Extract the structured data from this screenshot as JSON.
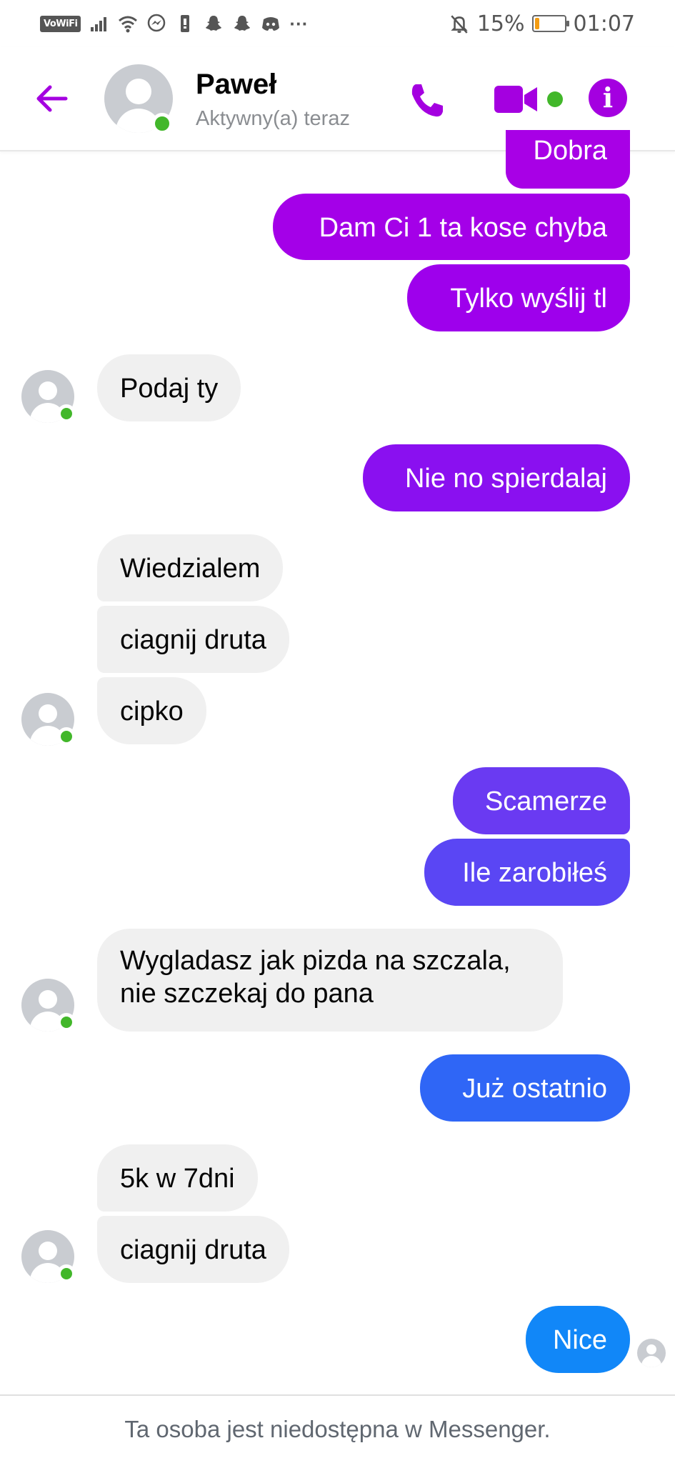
{
  "status_bar": {
    "vowifi": "VoWiFi",
    "battery_percent": "15%",
    "battery_level": 0.15,
    "time": "01:07",
    "more": "···",
    "icons": [
      "signal-icon",
      "wifi-icon",
      "messenger-icon",
      "phone-alert-icon",
      "snapchat-icon",
      "snapchat-icon",
      "discord-icon",
      "mute-bell-icon",
      "battery-icon"
    ]
  },
  "header": {
    "name": "Paweł",
    "status": "Aktywny(a) teraz",
    "accent_color": "#a400e0",
    "icons": [
      "back-arrow-icon",
      "phone-icon",
      "video-camera-icon",
      "info-icon"
    ]
  },
  "messages": [
    {
      "dir": "out",
      "text": "Dobra",
      "color": "#a800e6"
    },
    {
      "dir": "out",
      "text": "Dam Ci 1 ta kose chyba",
      "color": "#a400e8"
    },
    {
      "dir": "out",
      "text": "Tylko wyślij tl",
      "color": "#9e00ec"
    },
    {
      "dir": "in",
      "text": "Podaj ty"
    },
    {
      "dir": "out",
      "text": "Nie no spierdalaj",
      "color": "#8a10f0"
    },
    {
      "dir": "in",
      "text": "Wiedzialem"
    },
    {
      "dir": "in",
      "text": "ciagnij druta"
    },
    {
      "dir": "in",
      "text": "cipko"
    },
    {
      "dir": "out",
      "text": "Scamerze",
      "color": "#6a3af2"
    },
    {
      "dir": "out",
      "text": "Ile zarobiłeś",
      "color": "#5a46f4"
    },
    {
      "dir": "in",
      "text": "Wygladasz jak pizda na szczala, nie szczekaj do pana"
    },
    {
      "dir": "out",
      "text": "Już ostatnio",
      "color": "#2f66f6"
    },
    {
      "dir": "in",
      "text": "5k w 7dni"
    },
    {
      "dir": "in",
      "text": "ciagnij druta"
    },
    {
      "dir": "out",
      "text": "Nice",
      "color": "#1187f8"
    }
  ],
  "footer": {
    "text": "Ta osoba jest niedostępna w Messenger."
  }
}
